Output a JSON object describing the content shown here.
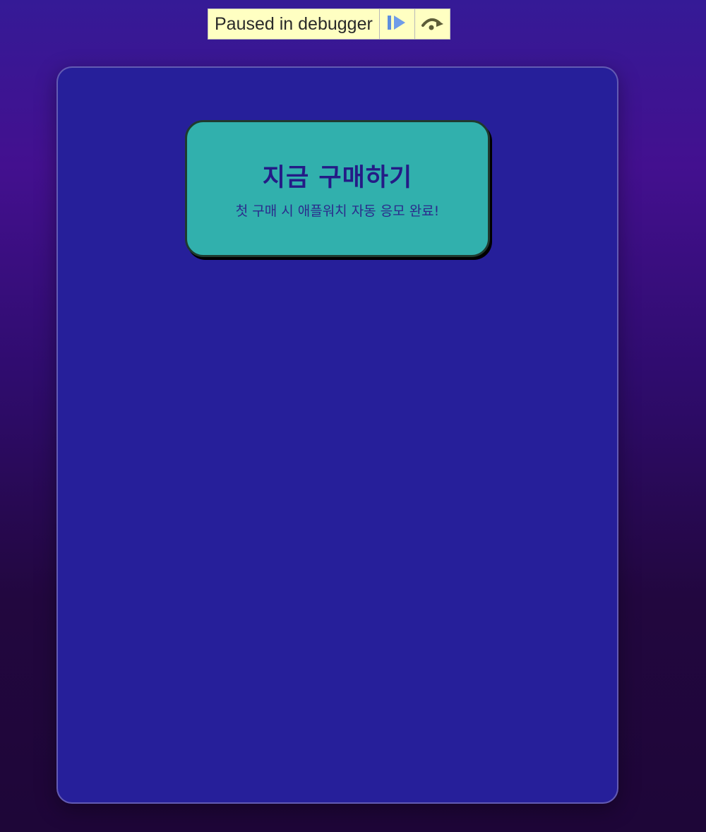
{
  "debugger": {
    "status_label": "Paused in debugger",
    "resume_icon": "resume-icon",
    "step_over_icon": "step-over-icon"
  },
  "cta": {
    "title": "지금 구매하기",
    "subtitle": "첫 구매 시 애플워치 자동 응모 완료!"
  },
  "colors": {
    "panel_background": "#261f9a",
    "card_background": "#31b0ad",
    "card_title": "#241b86",
    "debugger_background": "#ffffc2"
  }
}
